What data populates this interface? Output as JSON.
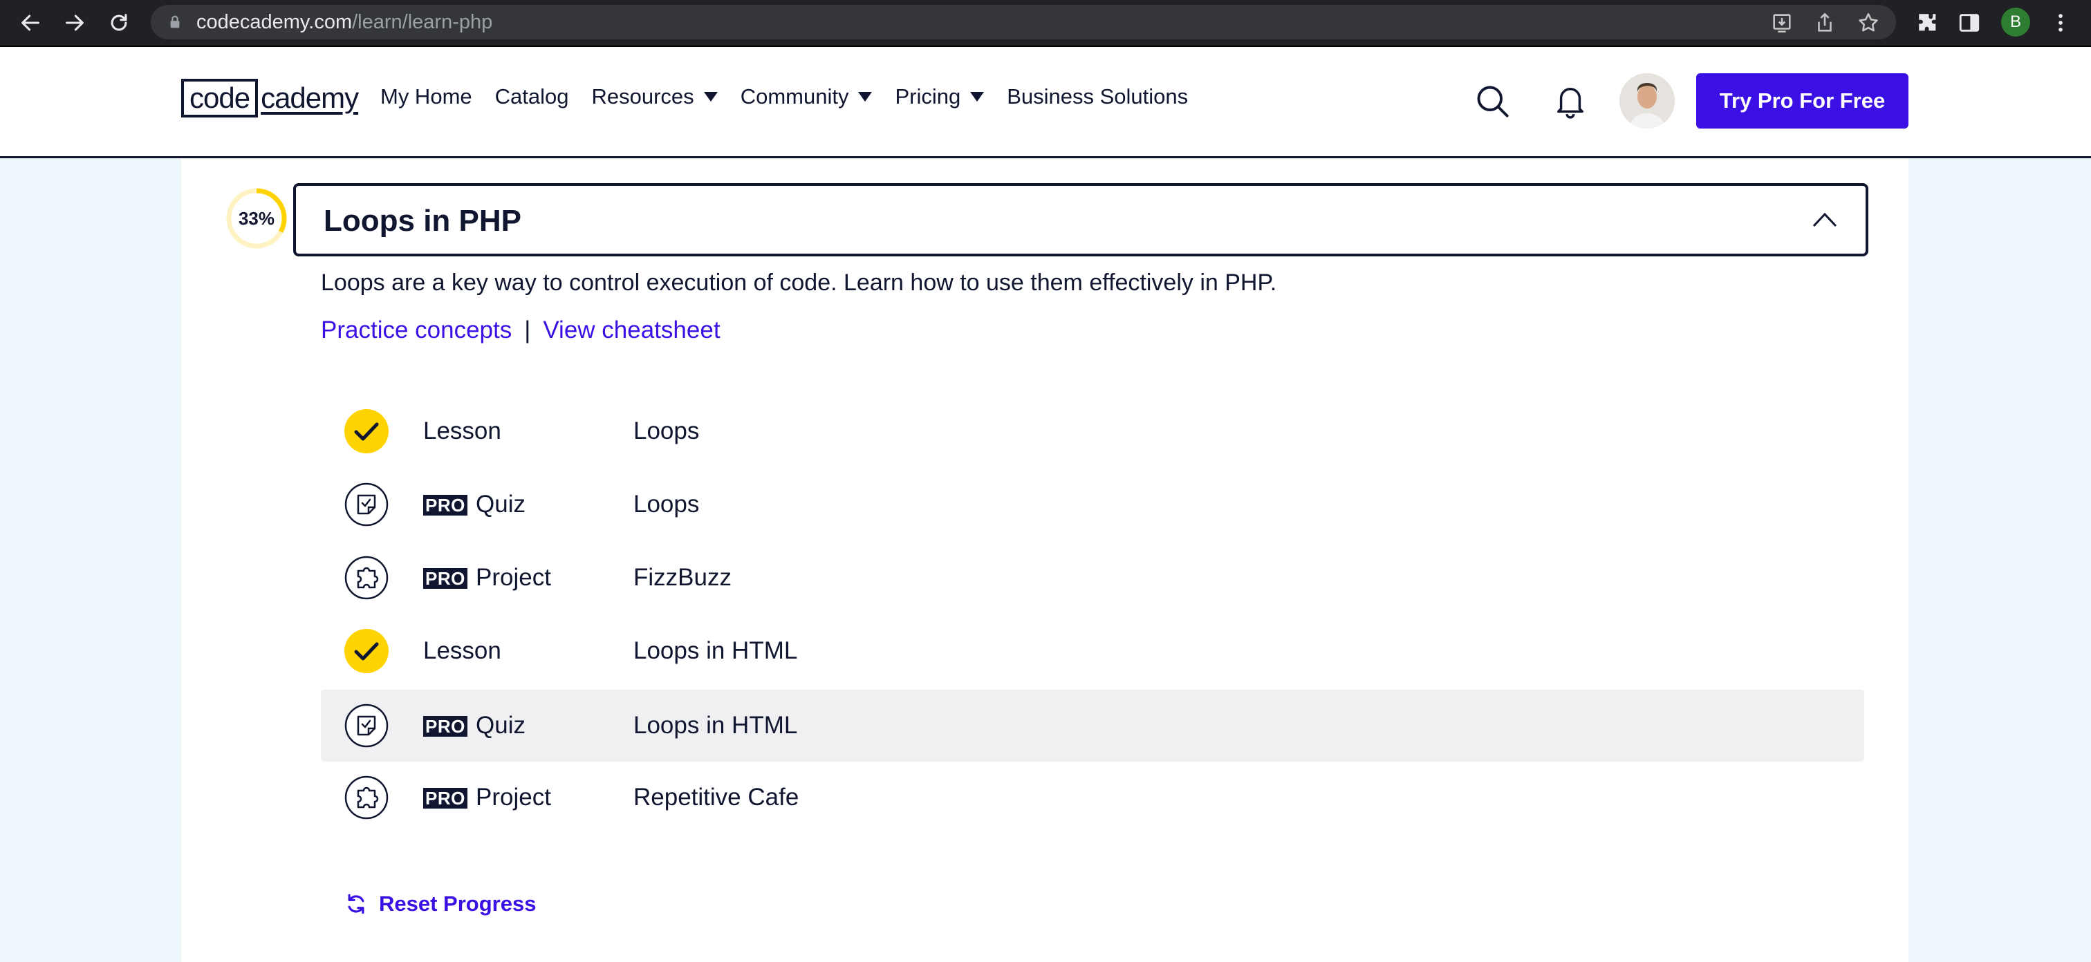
{
  "browser": {
    "url_domain": "codecademy.com",
    "url_path": "/learn/learn-php",
    "profile_initial": "B"
  },
  "nav": {
    "logo_box": "code",
    "logo_rest": "cademy",
    "links": [
      {
        "label": "My Home",
        "dropdown": false
      },
      {
        "label": "Catalog",
        "dropdown": false
      },
      {
        "label": "Resources",
        "dropdown": true
      },
      {
        "label": "Community",
        "dropdown": true
      },
      {
        "label": "Pricing",
        "dropdown": true
      },
      {
        "label": "Business Solutions",
        "dropdown": false
      }
    ],
    "cta": "Try Pro For Free"
  },
  "module": {
    "progress": "33%",
    "progress_fraction": 0.33,
    "title": "Loops in PHP",
    "description": "Loops are a key way to control execution of code. Learn how to use them effectively in PHP.",
    "practice_link": "Practice concepts",
    "separator": "|",
    "cheatsheet_link": "View cheatsheet",
    "items": [
      {
        "icon": "checkmark-icon",
        "pro": false,
        "type": "Lesson",
        "name": "Loops",
        "completed": true
      },
      {
        "icon": "quiz-icon",
        "pro": true,
        "type": "Quiz",
        "name": "Loops",
        "completed": false
      },
      {
        "icon": "puzzle-icon",
        "pro": true,
        "type": "Project",
        "name": "FizzBuzz",
        "completed": false
      },
      {
        "icon": "checkmark-icon",
        "pro": false,
        "type": "Lesson",
        "name": "Loops in HTML",
        "completed": true
      },
      {
        "icon": "quiz-icon",
        "pro": true,
        "type": "Quiz",
        "name": "Loops in HTML",
        "completed": false,
        "hovered": true
      },
      {
        "icon": "puzzle-icon",
        "pro": true,
        "type": "Project",
        "name": "Repetitive Cafe",
        "completed": false
      }
    ],
    "pro_badge": "PRO",
    "reset_label": "Reset Progress"
  },
  "colors": {
    "brand": "#3a10e5",
    "navy": "#10162f",
    "yellow": "#ffd300",
    "page_bg": "#eef7fc",
    "row_hover": "#f0f0f2"
  }
}
